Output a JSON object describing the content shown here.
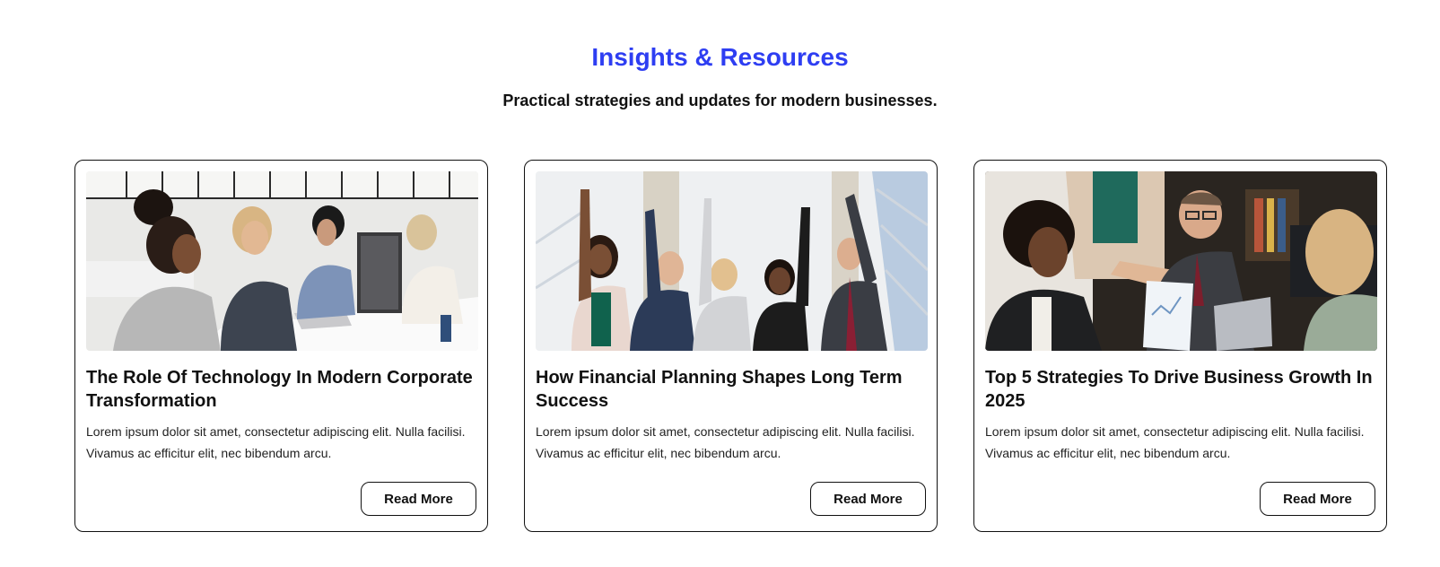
{
  "section": {
    "title": "Insights & Resources",
    "subtitle": "Practical strategies and updates for modern businesses."
  },
  "cards": [
    {
      "image_alt": "Team collaborating at an office table with laptops",
      "title": "The Role Of Technology In Modern Corporate Transformation",
      "excerpt": "Lorem ipsum dolor sit amet, consectetur adipiscing elit. Nulla facilisi. Vivamus ac efficitur elit, nec bibendum arcu.",
      "button_label": "Read More"
    },
    {
      "image_alt": "Business team celebrating with raised fists",
      "title": "How Financial Planning Shapes Long Term Success",
      "excerpt": "Lorem ipsum dolor sit amet, consectetur adipiscing elit. Nulla facilisi. Vivamus ac efficitur elit, nec bibendum arcu.",
      "button_label": "Read More"
    },
    {
      "image_alt": "Colleagues discussing documents in a meeting",
      "title": "Top 5 Strategies To Drive Business Growth In 2025",
      "excerpt": "Lorem ipsum dolor sit amet, consectetur adipiscing elit. Nulla facilisi. Vivamus ac efficitur elit, nec bibendum arcu.",
      "button_label": "Read More"
    }
  ],
  "colors": {
    "accent": "#2e3ef2",
    "text": "#111111",
    "card_border": "#111111",
    "background": "#ffffff"
  }
}
